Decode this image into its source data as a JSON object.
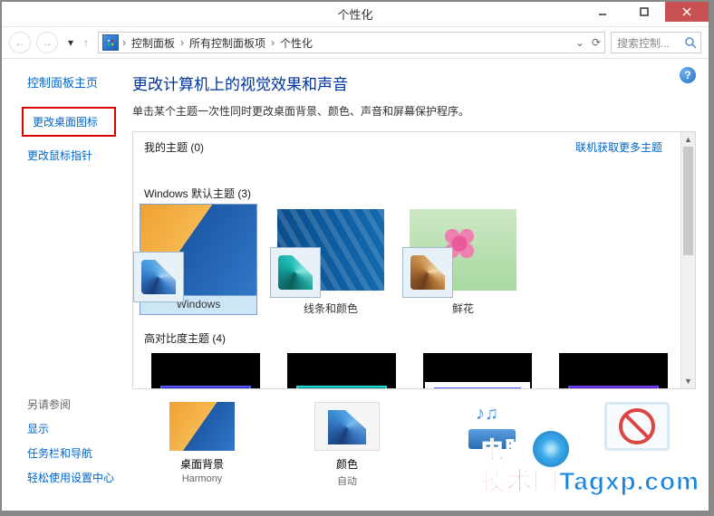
{
  "window": {
    "title": "个性化"
  },
  "breadcrumb": {
    "items": [
      "控制面板",
      "所有控制面板项",
      "个性化"
    ]
  },
  "search": {
    "placeholder": "搜索控制..."
  },
  "sidebar": {
    "title": "控制面板主页",
    "items": [
      {
        "label": "更改桌面图标",
        "highlighted": true
      },
      {
        "label": "更改鼠标指针",
        "highlighted": false
      }
    ]
  },
  "seeAlso": {
    "heading": "另请参阅",
    "links": [
      "显示",
      "任务栏和导航",
      "轻松使用设置中心"
    ]
  },
  "main": {
    "title": "更改计算机上的视觉效果和声音",
    "subtitle": "单击某个主题一次性同时更改桌面背景、颜色、声音和屏幕保护程序。"
  },
  "sections": {
    "myThemes": {
      "label": "我的主题 (0)",
      "link": "联机获取更多主题"
    },
    "defaultThemes": {
      "label": "Windows 默认主题 (3)",
      "items": [
        {
          "label": "Windows",
          "selected": true
        },
        {
          "label": "线条和颜色",
          "selected": false
        },
        {
          "label": "鲜花",
          "selected": false
        }
      ]
    },
    "highContrast": {
      "label": "高对比度主题 (4)"
    }
  },
  "bottom": {
    "items": [
      {
        "label": "桌面背景",
        "sub": "Harmony"
      },
      {
        "label": "颜色",
        "sub": "自动"
      },
      {
        "label": "",
        "sub": ""
      },
      {
        "label": "",
        "sub": ""
      }
    ]
  },
  "watermark": {
    "line1": "电脑",
    "line2_a": "技术网",
    "line2_b": "Tagxp.com"
  }
}
